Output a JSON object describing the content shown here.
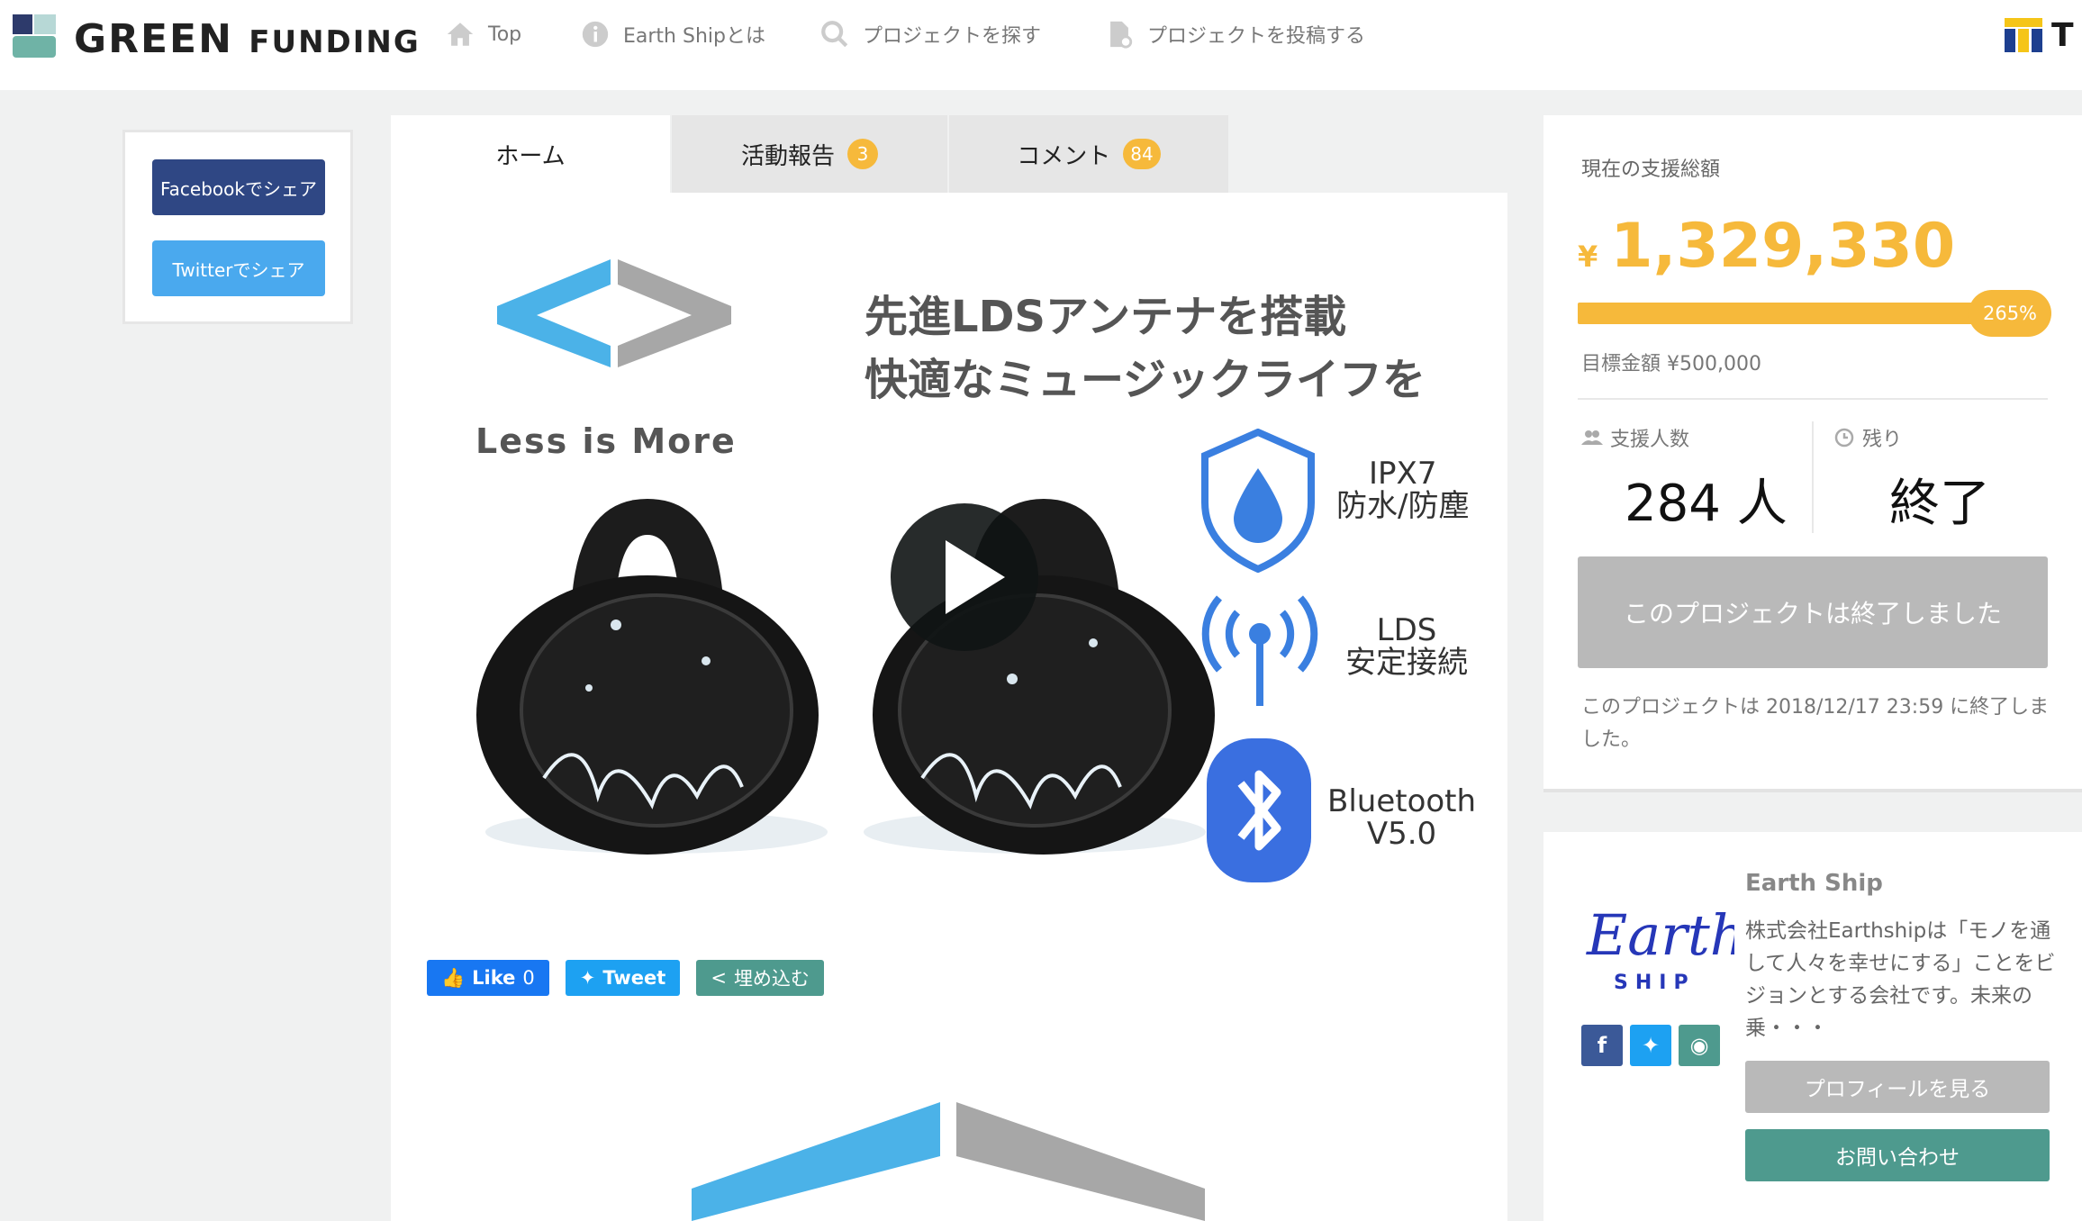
{
  "header": {
    "logo_main": "GREEN",
    "logo_sub": "FUNDING",
    "nav": [
      {
        "label": "Top",
        "icon": "home-icon"
      },
      {
        "label": "Earth Shipとは",
        "icon": "info-icon"
      },
      {
        "label": "プロジェクトを探す",
        "icon": "search-icon"
      },
      {
        "label": "プロジェクトを投稿する",
        "icon": "document-icon"
      }
    ],
    "tpoint_label": "T"
  },
  "share": {
    "facebook": "Facebookでシェア",
    "twitter": "Twitterでシェア"
  },
  "tabs": [
    {
      "label": "ホーム"
    },
    {
      "label": "活動報告",
      "count": "3"
    },
    {
      "label": "コメント",
      "count": "84"
    }
  ],
  "hero": {
    "tagline_1": "先進LDSアンテナを搭載",
    "tagline_2": "快適なミュージックライフを",
    "brand": "Less is More",
    "features": [
      {
        "line1": "IPX7",
        "line2": "防水/防塵"
      },
      {
        "line1": "LDS",
        "line2": "安定接続"
      },
      {
        "line1": "Bluetooth",
        "line2": "V5.0"
      }
    ]
  },
  "social": {
    "like": "Like",
    "like_count": "0",
    "tweet": "Tweet",
    "embed": "埋め込む"
  },
  "funding": {
    "label": "現在の支援総額",
    "currency": "¥",
    "amount": "1,329,330",
    "progress_percent": 265,
    "progress_label": "265%",
    "goal": "目標金額 ¥500,000",
    "supporters_label": "支援人数",
    "supporters_value": "284 人",
    "remaining_label": "残り",
    "remaining_value": "終了",
    "ended_button": "このプロジェクトは終了しました",
    "ended_note": "このプロジェクトは 2018/12/17 23:59 に終了しました。"
  },
  "owner": {
    "name": "Earth Ship",
    "logo_text": "Earth",
    "logo_sub": "SHIP",
    "description": "株式会社Earthshipは「モノを通して人々を幸せにする」ことをビジョンとする会社です。未来の乗・・・",
    "profile_button": "プロフィールを見る",
    "contact_button": "お問い合わせ"
  },
  "colors": {
    "accent": "#f6b93b",
    "facebook": "#2f4784",
    "twitter": "#4aa9ee",
    "teal": "#4e9a8e"
  }
}
